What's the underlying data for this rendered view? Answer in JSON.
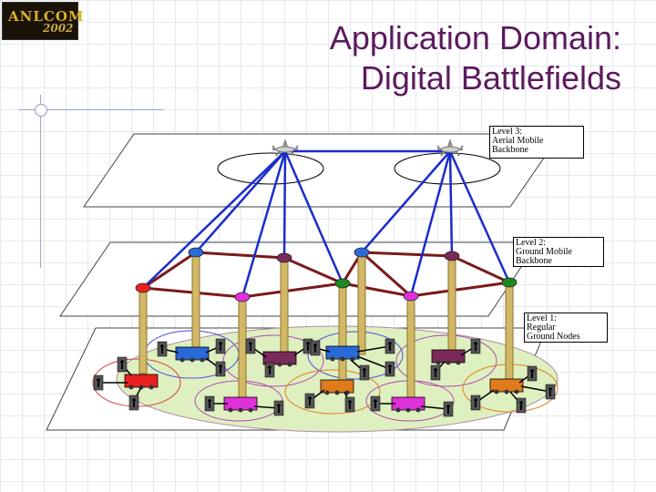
{
  "logo": {
    "text": "ANLCOM",
    "year": "2002"
  },
  "title": {
    "line1": "Application Domain:",
    "line2": "Digital Battlefields"
  },
  "levels": {
    "level3": {
      "line1": "Level 3:",
      "line2": "Aerial Mobile",
      "line3": "Backbone"
    },
    "level2": {
      "line1": "Level 2:",
      "line2": "Ground Mobile",
      "line3": "Backbone"
    },
    "level1": {
      "line1": "Level 1:",
      "line2": "Regular",
      "line3": "Ground Nodes"
    }
  },
  "colors": {
    "title": "#5c1a5e",
    "aerial_link": "#1a2ccc",
    "ground_link": "#7a1a1a",
    "pole": "#d2b866",
    "ground_field": "#dff0c0"
  }
}
